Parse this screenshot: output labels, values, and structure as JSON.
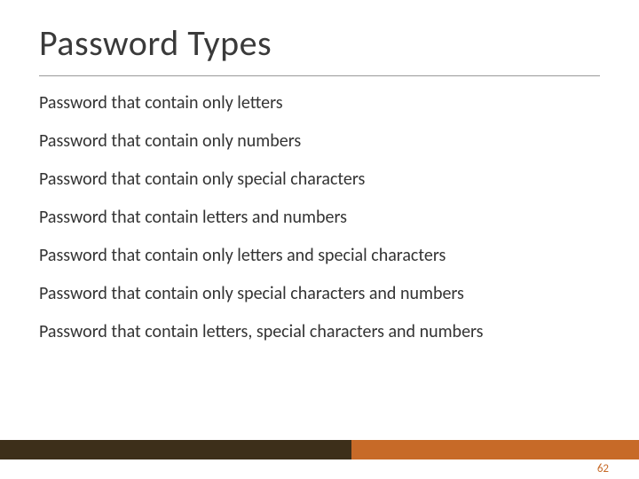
{
  "title": "Password Types",
  "items": [
    "Password that contain only letters",
    "Password that contain only numbers",
    "Password that contain only special characters",
    "Password that contain letters and numbers",
    "Password that contain only letters and special characters",
    "Password that contain only special characters and numbers",
    "Password that contain letters, special characters and numbers"
  ],
  "page_number": "62",
  "colors": {
    "accent": "#c76a28",
    "footer_dark": "#3d2f1a"
  }
}
